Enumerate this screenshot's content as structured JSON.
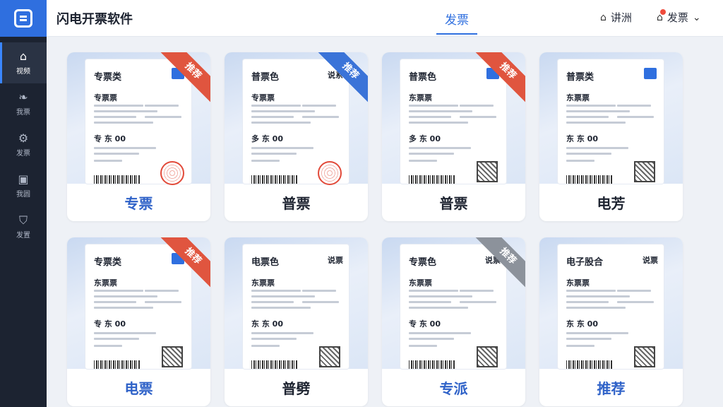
{
  "app": {
    "title": "闪电开票软件"
  },
  "header": {
    "active_tab": "发票",
    "btn_a": "讲洲",
    "btn_b": "发票"
  },
  "sidebar": {
    "items": [
      {
        "label": "视频",
        "icon": "home-icon"
      },
      {
        "label": "我票",
        "icon": "leaf-icon"
      },
      {
        "label": "发票",
        "icon": "gear-icon"
      },
      {
        "label": "我圆",
        "icon": "box-icon"
      },
      {
        "label": "发置",
        "icon": "shield-icon"
      }
    ]
  },
  "cards": [
    {
      "head": "专票类",
      "sub": "专票票",
      "amount": "专 东 00",
      "mark": "",
      "ribbon": "推荐",
      "ribbon_color": "#e0553f",
      "label": "专票",
      "label_color": "#2f62c8",
      "seal": true
    },
    {
      "head": "普票色",
      "sub": "专票票",
      "amount": "多 东 00",
      "mark": "说系",
      "ribbon": "推荐",
      "ribbon_color": "#3a73d8",
      "label": "普票",
      "label_color": "#1d2330",
      "seal": true
    },
    {
      "head": "普票色",
      "sub": "东票票",
      "amount": "多 东 00",
      "mark": "",
      "ribbon": "推荐",
      "ribbon_color": "#e0553f",
      "label": "普票",
      "label_color": "#1d2330",
      "seal": false
    },
    {
      "head": "普票类",
      "sub": "东票票",
      "amount": "东 东 00",
      "mark": "",
      "ribbon": "",
      "ribbon_color": "",
      "label": "电芳",
      "label_color": "#1d2330",
      "seal": false
    },
    {
      "head": "专票类",
      "sub": "东票票",
      "amount": "专 东 00",
      "mark": "",
      "ribbon": "推荐",
      "ribbon_color": "#e0553f",
      "label": "电票",
      "label_color": "#2f62c8",
      "seal": false
    },
    {
      "head": "电票色",
      "sub": "东票票",
      "amount": "东 东 00",
      "mark": "说票",
      "ribbon": "",
      "ribbon_color": "",
      "label": "普劈",
      "label_color": "#1d2330",
      "seal": false
    },
    {
      "head": "专票色",
      "sub": "东票票",
      "amount": "专 东 00",
      "mark": "说票",
      "ribbon": "推荐",
      "ribbon_color": "#8c929b",
      "label": "专派",
      "label_color": "#2f62c8",
      "seal": false
    },
    {
      "head": "电子股合",
      "sub": "东票票",
      "amount": "东 东 00",
      "mark": "说票",
      "ribbon": "",
      "ribbon_color": "",
      "label": "推荐",
      "label_color": "#2f62c8",
      "seal": false
    }
  ]
}
